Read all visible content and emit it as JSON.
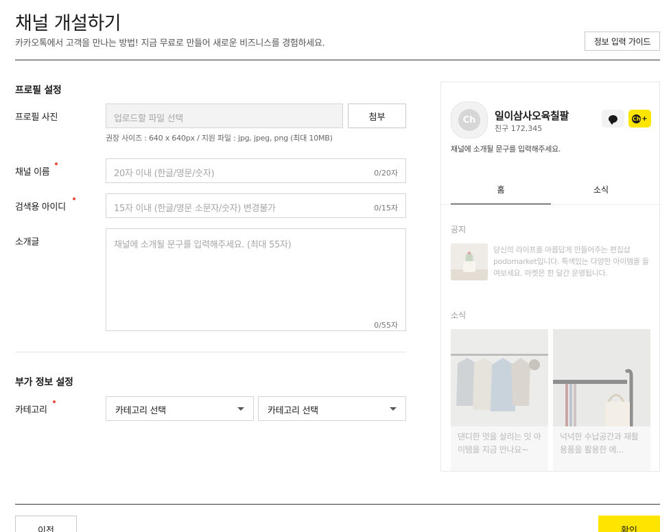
{
  "header": {
    "title": "채널 개설하기",
    "subtitle": "카카오톡에서 고객을 만나는 방법! 지금 무료로 만들어 새로운 비즈니스를 경험하세요.",
    "guide_button": "정보 입력 가이드"
  },
  "profile_section": {
    "title": "프로필 설정",
    "photo": {
      "label": "프로필 사진",
      "placeholder": "업로드할 파일 선택",
      "attach_button": "첨부",
      "hint": "권장 사이즈 : 640 x 640px / 지원 파일 : jpg, jpeg, png (최대 10MB)"
    },
    "channel_name": {
      "label": "채널 이름",
      "placeholder": "20자 이내 (한글/영문/숫자)",
      "counter": "0/20자"
    },
    "search_id": {
      "label": "검색용 아이디",
      "placeholder": "15자 이내 (한글/영문 소문자/숫자) 변경불가",
      "counter": "0/15자"
    },
    "intro": {
      "label": "소개글",
      "placeholder": "채널에 소개될 문구를 입력해주세요. (최대 55자)",
      "counter": "0/55자"
    }
  },
  "extra_section": {
    "title": "부가 정보 설정",
    "category": {
      "label": "카테고리",
      "select1": "카테고리 선택",
      "select2": "카테고리 선택"
    }
  },
  "footer": {
    "prev_button": "이전",
    "confirm_button": "확인"
  },
  "preview": {
    "avatar_text": "Ch",
    "name": "일이삼사오육칠팔",
    "friends": "친구 172,345",
    "intro": "채널에 소개될 문구를 입력해주세요.",
    "tabs": [
      "홈",
      "소식"
    ],
    "notice_heading": "공지",
    "notice_text": "당신의 라이프를 아름답게 만들어주는 편집샵 podomarket입니다. 특색있는 다양한 아이템을 들여보세요. 마켓은 한 달간 운영됩니다.",
    "news_heading": "소식",
    "cards": [
      {
        "caption": "댄디한 멋을 살리는 잇 아이템을 지금 만나요~"
      },
      {
        "caption": "넉넉한 수납공간과 재활용품을 활용한 에..."
      }
    ]
  },
  "colors": {
    "accent": "#fee500",
    "required": "#e84a3a",
    "divider": "#333333"
  }
}
